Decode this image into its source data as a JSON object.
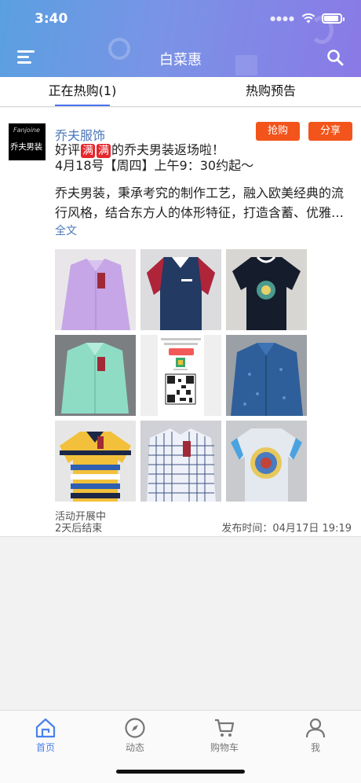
{
  "status_bar": {
    "time": "3:40"
  },
  "header": {
    "title": "白菜惠"
  },
  "tabs": [
    {
      "label": "正在热购(1)",
      "active": true
    },
    {
      "label": "热购预告",
      "active": false
    }
  ],
  "post": {
    "avatar_text": "乔夫男装",
    "avatar_brand": "Fanjoine",
    "shop_name": "乔夫服饰",
    "buy_label": "抢购",
    "share_label": "分享",
    "line1_a": "好评",
    "line1_em1": "满",
    "line1_em2": "满",
    "line1_b": "的乔夫男装返场啦！",
    "line2": "4月18号【周四】上午9：30约起～",
    "description": "乔夫男装，秉承考究的制作工艺，融入欧美经典的流行风格，结合东方人的体形特征，打造含蓄、优雅…",
    "full_text_link": "全文",
    "images": [
      {
        "name": "lavender-shirt",
        "color": "#c6a6e6"
      },
      {
        "name": "navy-polo-red-sleeves",
        "color": "#233a63"
      },
      {
        "name": "black-tshirt-print",
        "color": "#151d2c"
      },
      {
        "name": "mint-shirt",
        "color": "#8fdcc4"
      },
      {
        "name": "qr-code-card",
        "color": "#ffffff"
      },
      {
        "name": "blue-patterned-shirt",
        "color": "#2f5f9a"
      },
      {
        "name": "striped-polo",
        "color": "#f2c03a"
      },
      {
        "name": "plaid-shirt",
        "color": "#e8ecf6"
      },
      {
        "name": "white-tshirt-medallion",
        "color": "#e4e8ef"
      }
    ],
    "qr_card": {
      "line1": "我的相册共享二维码",
      "line2": "扫码可免费一键转图",
      "button": "转发相册",
      "caption": "乔夫服饰"
    },
    "status_line1": "活动开展中",
    "status_line2": "2天后结束",
    "publish_time": "发布时间：04月17日 19:19"
  },
  "bottom_nav": [
    {
      "label": "首页",
      "icon": "home-icon",
      "active": true
    },
    {
      "label": "动态",
      "icon": "compass-icon",
      "active": false
    },
    {
      "label": "购物车",
      "icon": "cart-icon",
      "active": false
    },
    {
      "label": "我",
      "icon": "user-icon",
      "active": false
    }
  ],
  "colors": {
    "accent": "#4a80ea",
    "button": "#f2541b",
    "link": "#4a77b9"
  }
}
